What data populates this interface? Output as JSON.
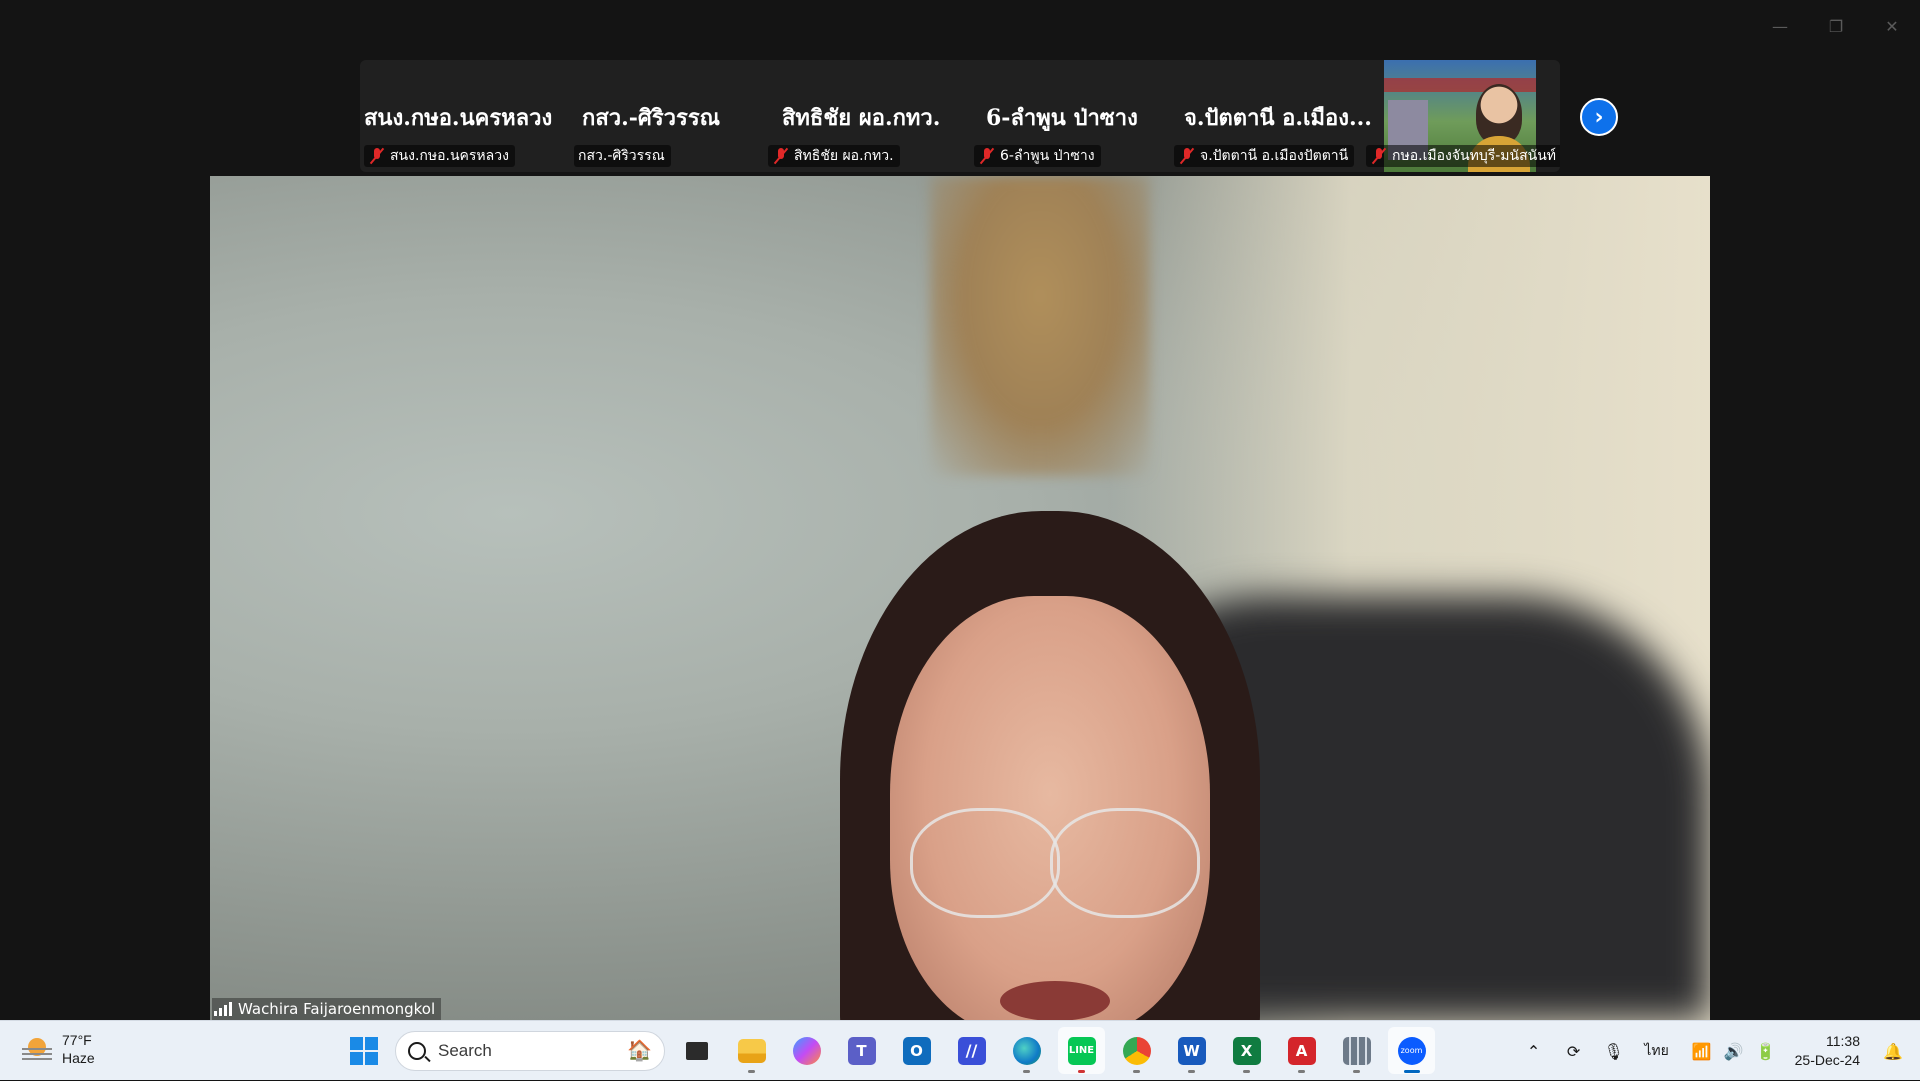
{
  "window": {
    "controls": {
      "minimize": "—",
      "restore": "❐",
      "close": "✕"
    }
  },
  "participants_strip": [
    {
      "name": "สนง.กษอ.นครหลวง",
      "tag": "สนง.กษอ.นครหลวง",
      "muted": true
    },
    {
      "name": "กสว.-ศิริวรรณ",
      "tag": "กสว.-ศิริวรรณ",
      "muted": false
    },
    {
      "name": "สิทธิชัย ผอ.กทว.",
      "tag": "สิทธิชัย ผอ.กทว.",
      "muted": true
    },
    {
      "name": "6-ลำพูน ป่าซาง",
      "tag": "6-ลำพูน ป่าซาง",
      "muted": true
    },
    {
      "name": "จ.ปัตตานี อ.เมือง...",
      "tag": "จ.ปัตตานี อ.เมืองปัตตานี",
      "muted": true
    },
    {
      "name": "",
      "tag": "กษอ.เมืองจันทบุรี-มนัสนันท์",
      "muted": true
    }
  ],
  "next_button": "›",
  "main_speaker": {
    "name": "Wachira Faijaroenmongkol"
  },
  "taskbar": {
    "weather": {
      "temp": "77°F",
      "condition": "Haze"
    },
    "search_placeholder": "Search",
    "apps": [
      "start-icon",
      "search",
      "task-view-icon",
      "file-explorer-icon",
      "copilot-icon",
      "teams-icon",
      "outlook-icon",
      "stylus-app-icon",
      "edge-icon",
      "line-icon",
      "chrome-icon",
      "word-icon",
      "excel-icon",
      "acrobat-icon",
      "calculator-icon",
      "zoom-icon"
    ],
    "tray": {
      "language": "ไทย"
    },
    "clock": {
      "time": "11:38",
      "date": "25-Dec-24"
    }
  },
  "colors": {
    "zoom_blue": "#0e71eb",
    "muted_red": "#e02828",
    "taskbar_bg": "#eaf0f7"
  }
}
